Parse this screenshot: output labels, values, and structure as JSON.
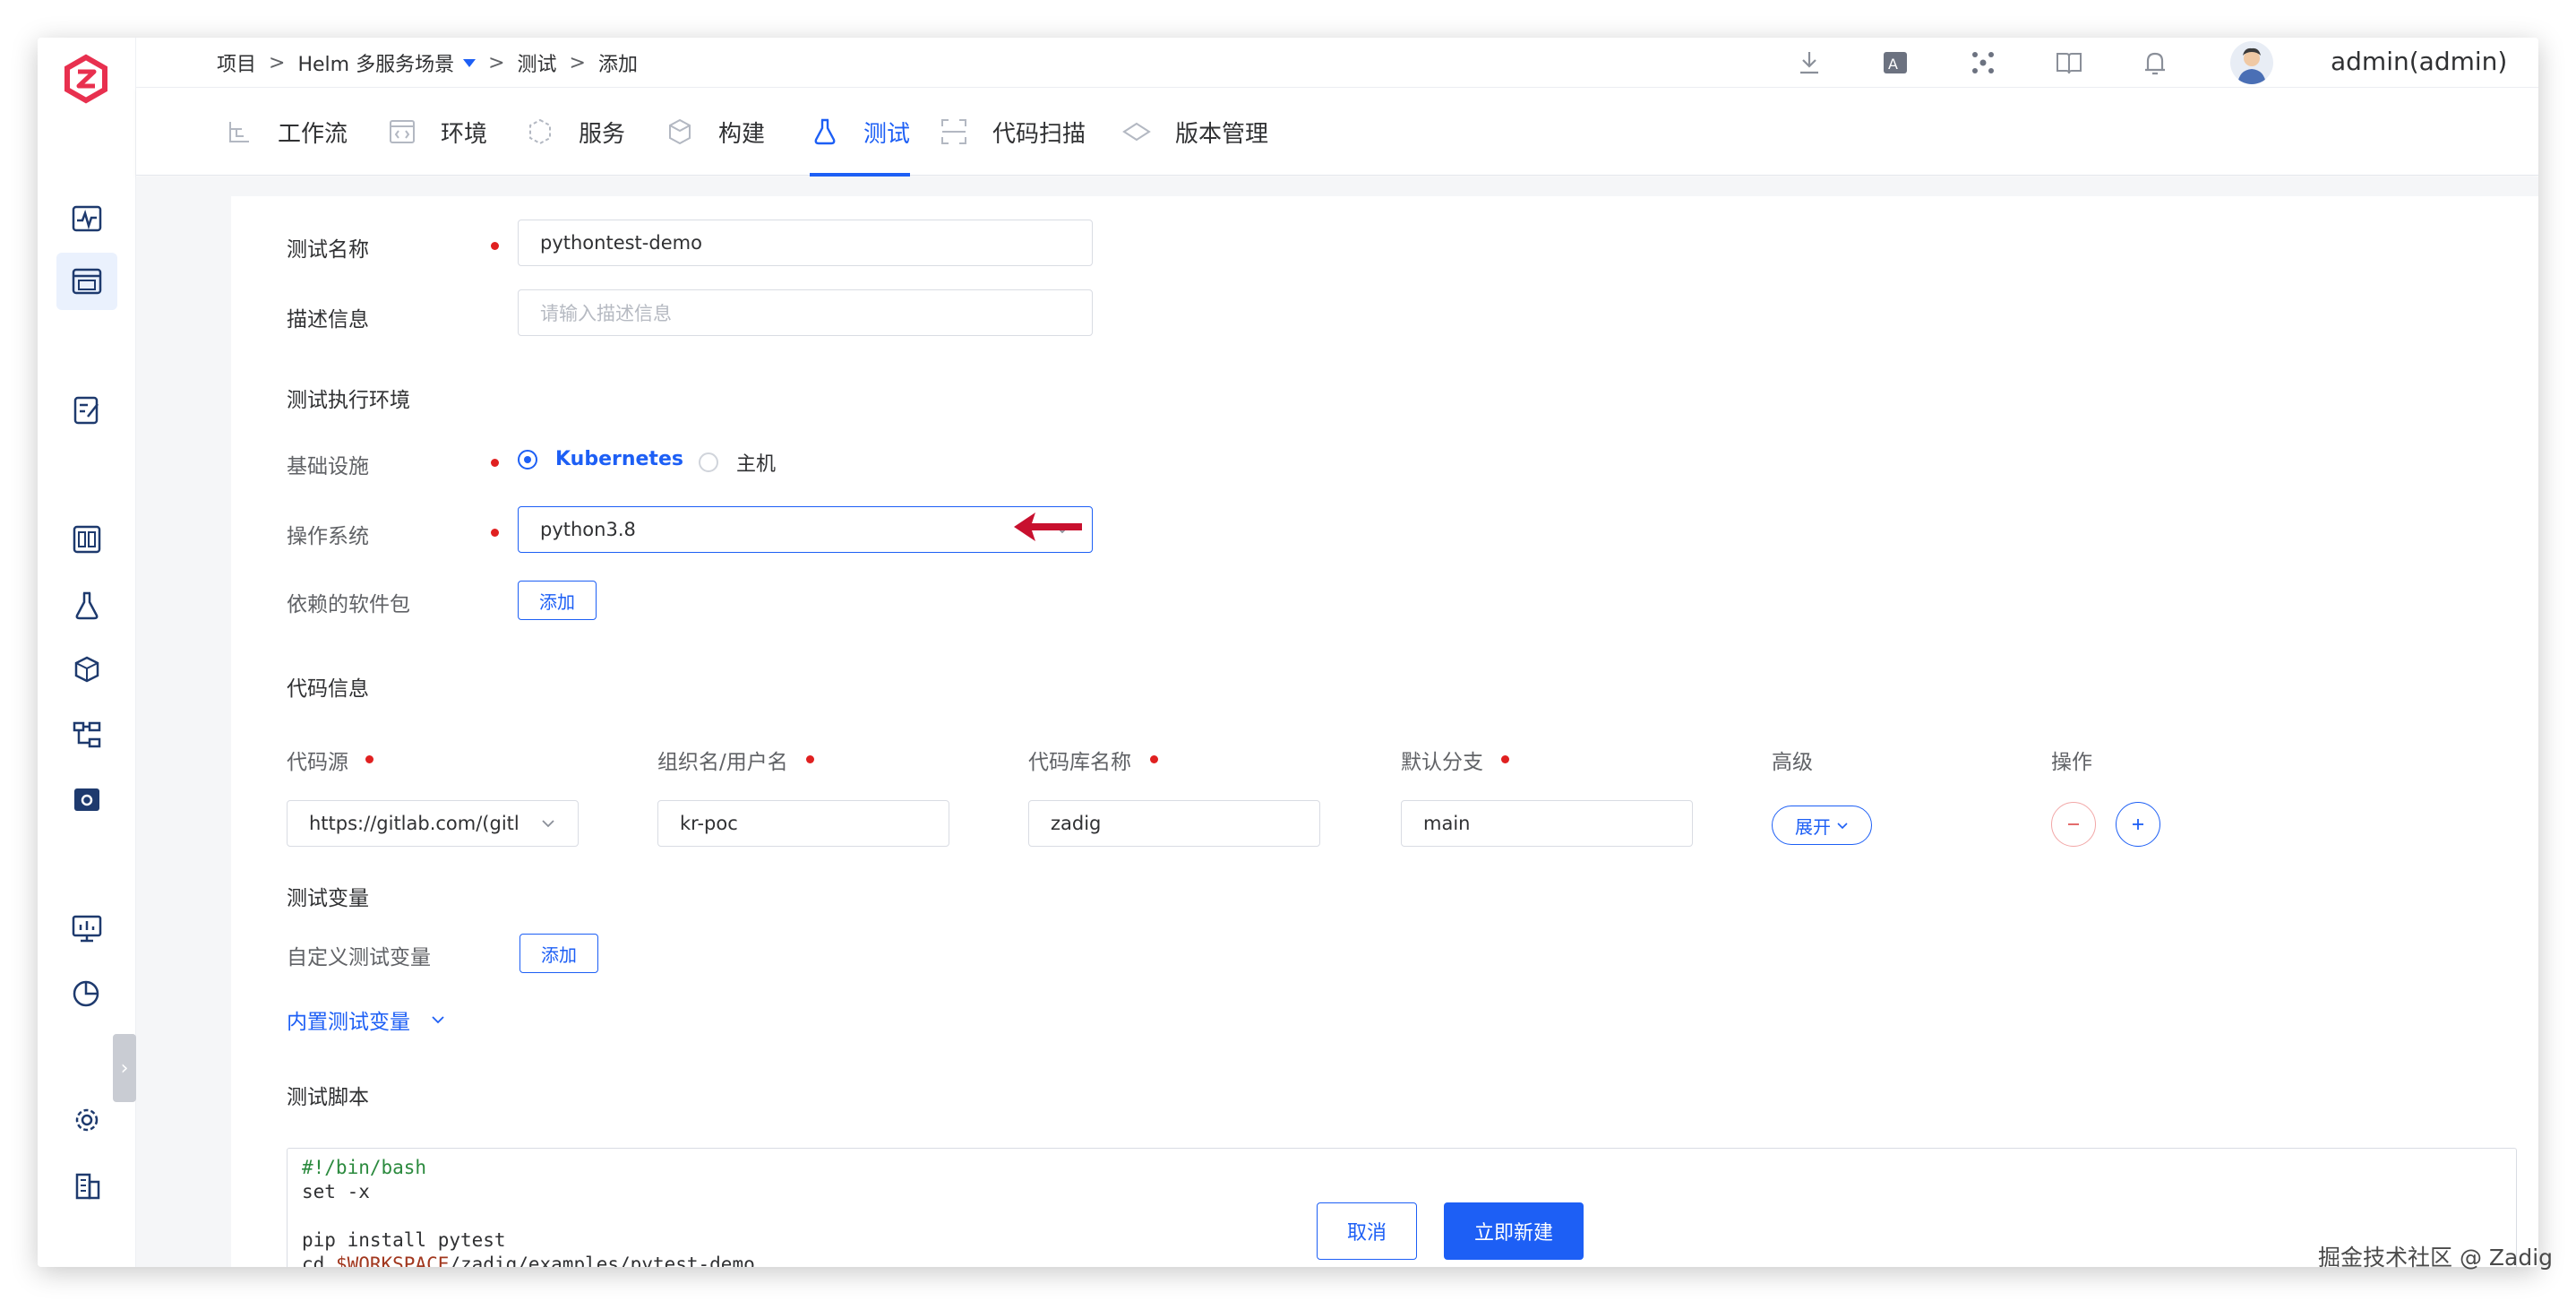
{
  "breadcrumb": {
    "project": "项目",
    "scenario": "Helm 多服务场景",
    "section": "测试",
    "page": "添加",
    "separator": ">"
  },
  "user": {
    "name": "admin(admin)"
  },
  "header_icons": [
    "download-icon",
    "translate-icon",
    "plugin-icon",
    "docs-icon",
    "bell-icon"
  ],
  "tabs": [
    {
      "label": "工作流",
      "icon": "workflow-icon"
    },
    {
      "label": "环境",
      "icon": "environment-icon"
    },
    {
      "label": "服务",
      "icon": "service-icon"
    },
    {
      "label": "构建",
      "icon": "build-icon"
    },
    {
      "label": "测试",
      "icon": "flask-icon",
      "active": true
    },
    {
      "label": "代码扫描",
      "icon": "scan-icon"
    },
    {
      "label": "版本管理",
      "icon": "version-icon"
    }
  ],
  "form": {
    "name_label": "测试名称",
    "name_value": "pythontest-demo",
    "desc_label": "描述信息",
    "desc_placeholder": "请输入描述信息",
    "env_section": "测试执行环境",
    "infra_label": "基础设施",
    "infra_options": [
      "Kubernetes",
      "主机"
    ],
    "infra_selected": "Kubernetes",
    "os_label": "操作系统",
    "os_value": "python3.8",
    "deps_label": "依赖的软件包",
    "deps_button": "添加"
  },
  "code": {
    "section": "代码信息",
    "headers": [
      "代码源",
      "组织名/用户名",
      "代码库名称",
      "默认分支",
      "高级",
      "操作"
    ],
    "source": "https://gitlab.com/(gitl",
    "org": "kr-poc",
    "repo": "zadig",
    "branch": "main",
    "expand_button": "展开"
  },
  "vars": {
    "section": "测试变量",
    "custom_label": "自定义测试变量",
    "add_button": "添加",
    "builtin_link": "内置测试变量"
  },
  "script": {
    "section": "测试脚本",
    "lines": [
      "#!/bin/bash",
      "set -x",
      "",
      "pip install pytest",
      "cd $WORKSPACE/zadig/examples/pytest-demo"
    ]
  },
  "actions": {
    "cancel": "取消",
    "create": "立即新建"
  },
  "watermark": "掘金技术社区 @ Zadig",
  "colors": {
    "accent": "#1d5ff5",
    "required": "#e02020",
    "arrow": "#c8102e",
    "logo": "#e8304f"
  }
}
